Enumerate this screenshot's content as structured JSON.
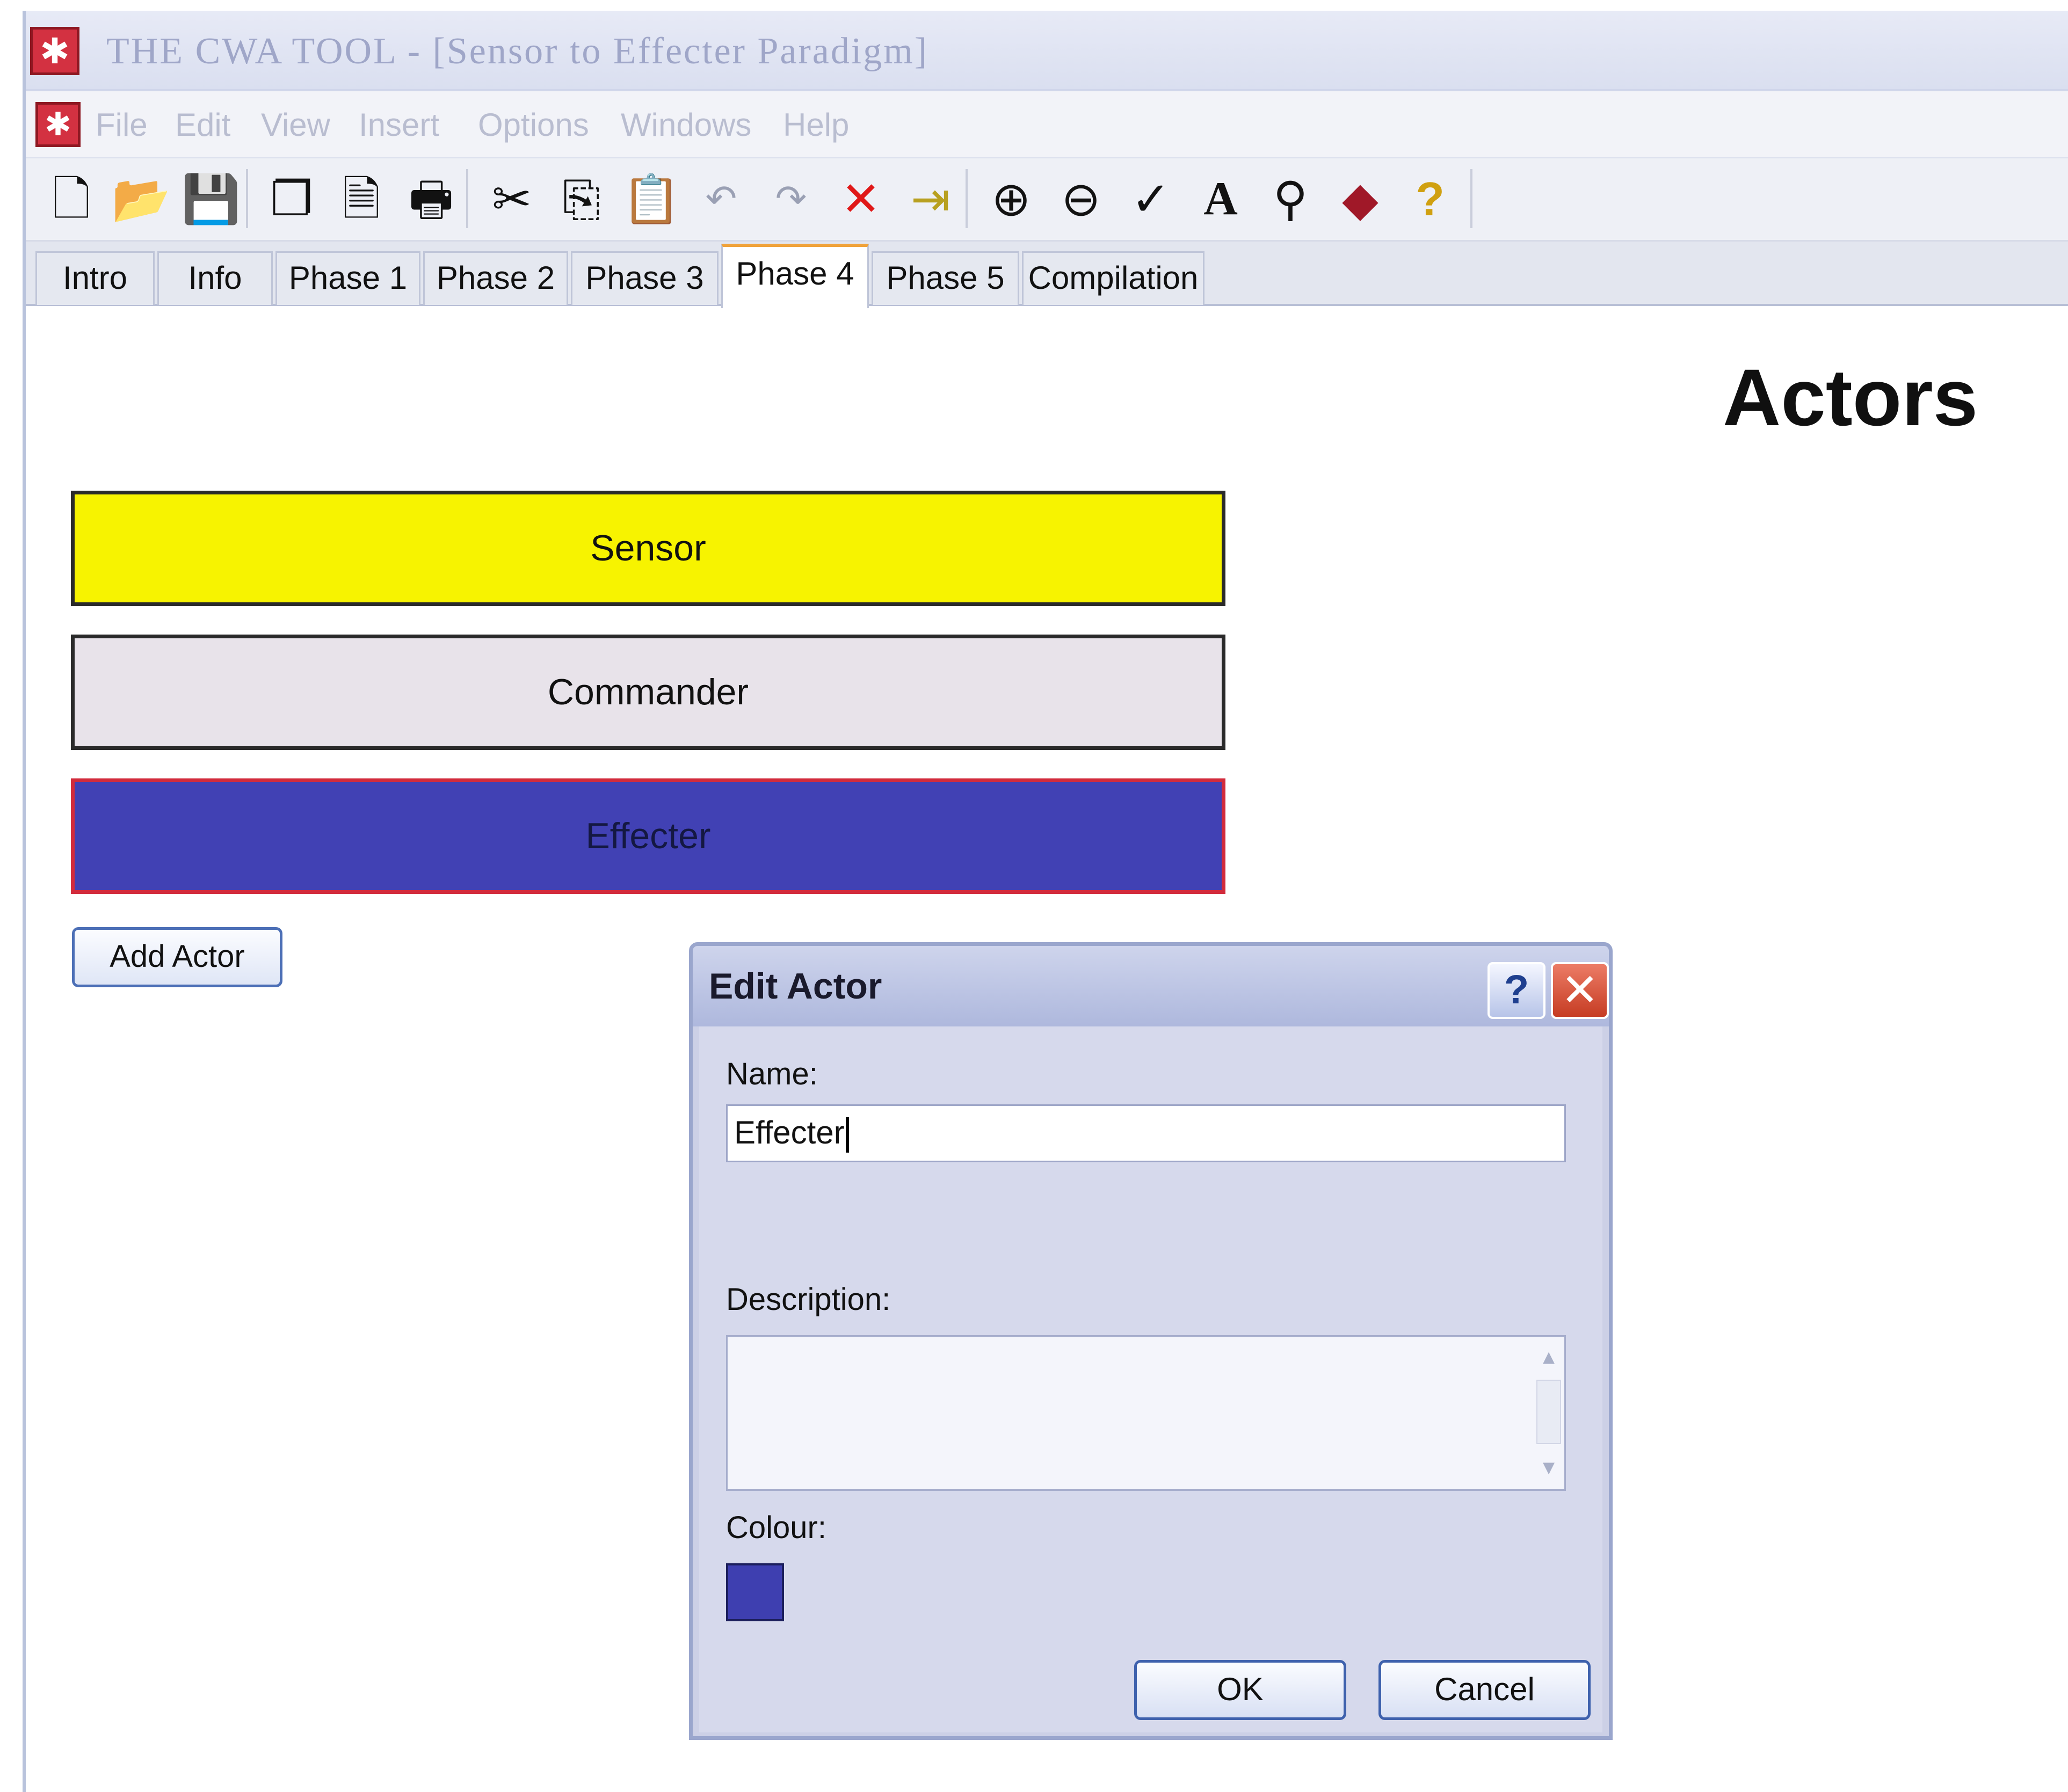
{
  "window": {
    "title": "THE CWA TOOL - [Sensor to Effecter Paradigm]"
  },
  "menu": {
    "items": [
      "File",
      "Edit",
      "View",
      "Insert",
      "Options",
      "Windows",
      "Help"
    ]
  },
  "toolbar": {
    "icons": [
      "new-document-icon",
      "open-folder-icon",
      "save-icon",
      "copy-page-icon",
      "print-preview-icon",
      "print-icon",
      "cut-icon",
      "copy-icon",
      "paste-icon",
      "undo-icon",
      "redo-icon",
      "delete-icon",
      "import-icon",
      "zoom-in-icon",
      "zoom-out-icon",
      "spell-check-icon",
      "font-icon",
      "find-icon",
      "book-icon",
      "help-icon"
    ]
  },
  "tabs": {
    "items": [
      "Intro",
      "Info",
      "Phase 1",
      "Phase 2",
      "Phase 3",
      "Phase 4",
      "Phase 5",
      "Compilation"
    ],
    "active": "Phase 4"
  },
  "page": {
    "heading": "Actors"
  },
  "actors": [
    {
      "name": "Sensor",
      "color": "#f7f300"
    },
    {
      "name": "Commander",
      "color": "#e8e3ea"
    },
    {
      "name": "Effecter",
      "color": "#4141b4"
    }
  ],
  "add_actor_label": "Add Actor",
  "dialog": {
    "title": "Edit Actor",
    "help_label": "?",
    "close_label": "✕",
    "name_label": "Name:",
    "name_value": "Effecter",
    "description_label": "Description:",
    "description_value": "",
    "colour_label": "Colour:",
    "colour_value": "#3e3fb0",
    "ok_label": "OK",
    "cancel_label": "Cancel"
  }
}
